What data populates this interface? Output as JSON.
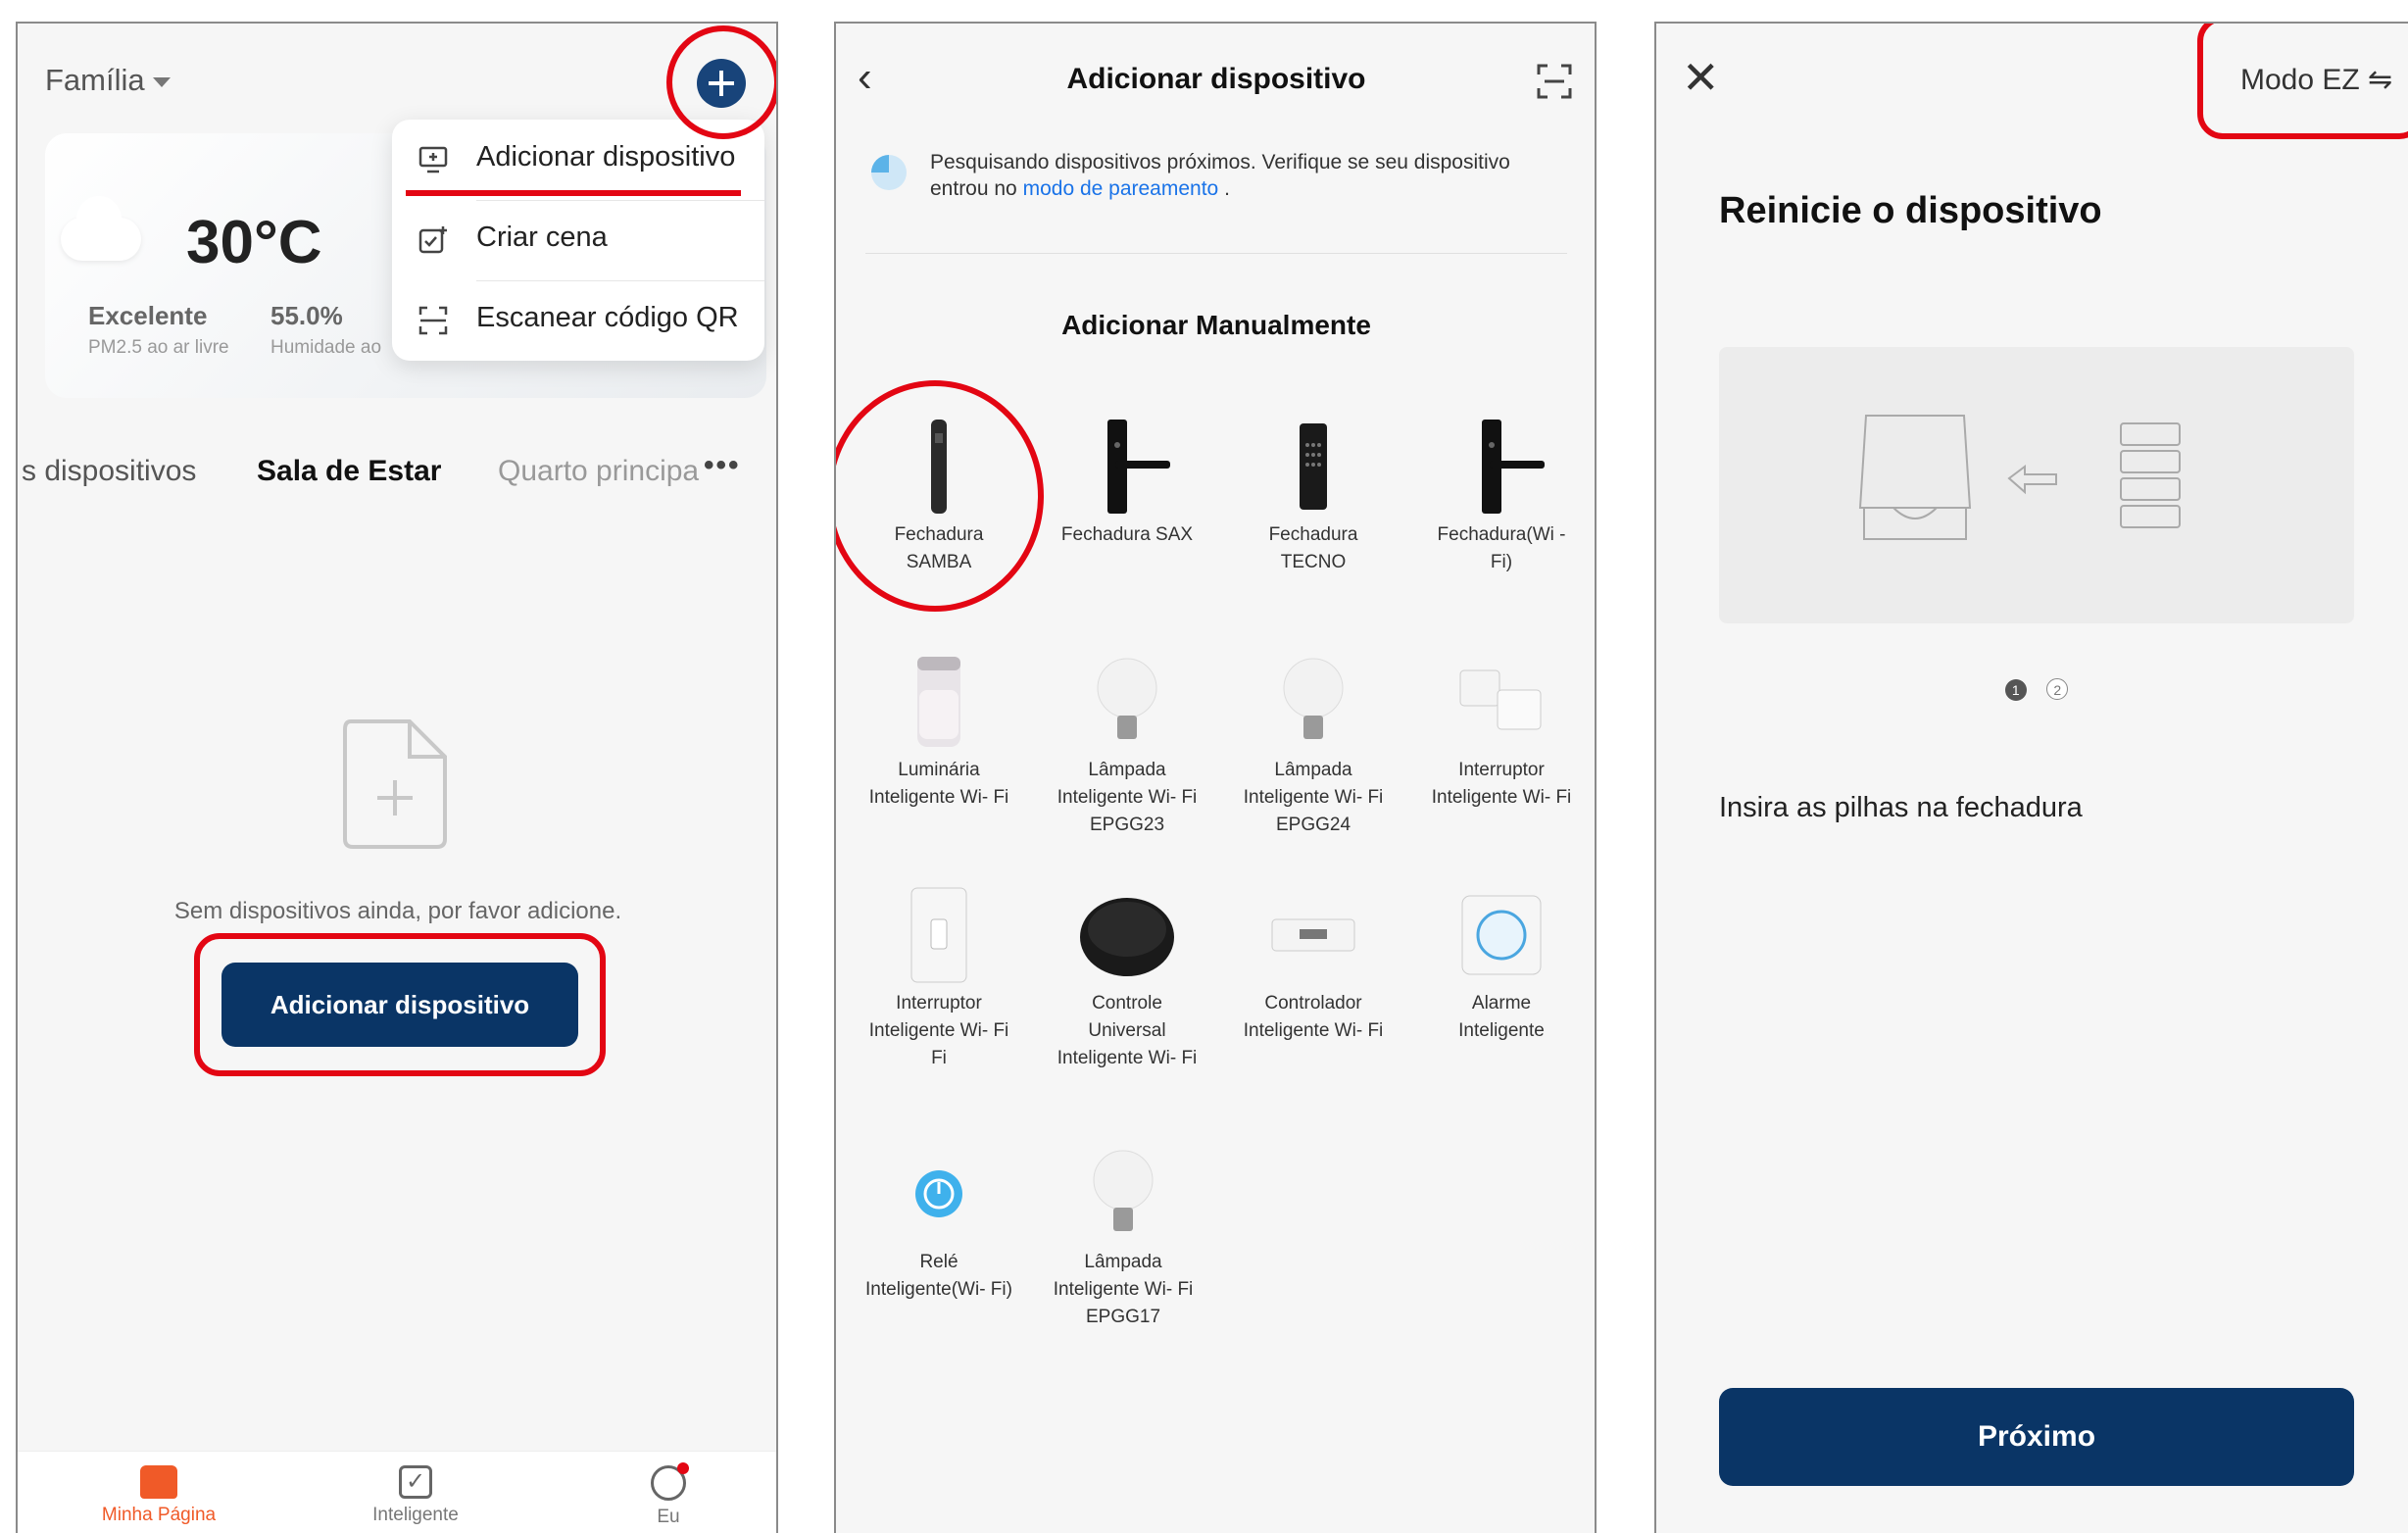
{
  "panel1": {
    "family_label": "Família",
    "temperature": "30°C",
    "air_quality_value": "Excelente",
    "air_quality_label": "PM2.5 ao ar livre",
    "humidity_value": "55.0%",
    "humidity_label": "Humidade ao",
    "menu": {
      "items": [
        {
          "label": "Adicionar dispositivo",
          "icon": "add-device-icon"
        },
        {
          "label": "Criar cena",
          "icon": "create-scene-icon"
        },
        {
          "label": "Escanear código QR",
          "icon": "qr-scan-icon"
        }
      ]
    },
    "tabs": [
      "s dispositivos",
      "Sala de Estar",
      "Quarto principa"
    ],
    "more_label": "•••",
    "empty_message": "Sem dispositivos ainda, por favor adicione.",
    "add_button": "Adicionar dispositivo",
    "bottom_nav": [
      {
        "label": "Minha Página",
        "active": true,
        "color": "#f05a28"
      },
      {
        "label": "Inteligente",
        "active": false
      },
      {
        "label": "Eu",
        "active": false
      }
    ]
  },
  "panel2": {
    "title": "Adicionar dispositivo",
    "search_text": "Pesquisando dispositivos próximos. Verifique se seu dispositivo entrou no",
    "search_link": "modo de pareamento",
    "search_end": ".",
    "manual_heading": "Adicionar Manualmente",
    "devices": [
      {
        "name": "Fechadura SAMBA"
      },
      {
        "name": "Fechadura SAX"
      },
      {
        "name": "Fechadura TECNO"
      },
      {
        "name": "Fechadura(Wi -Fi)"
      },
      {
        "name": "Luminária Inteligente Wi- Fi"
      },
      {
        "name": "Lâmpada Inteligente Wi- Fi EPGG23"
      },
      {
        "name": "Lâmpada Inteligente Wi- Fi EPGG24"
      },
      {
        "name": "Interruptor Inteligente Wi- Fi"
      },
      {
        "name": "Interruptor Inteligente Wi- Fi Fi"
      },
      {
        "name": "Controle Universal Inteligente Wi- Fi"
      },
      {
        "name": "Controlador Inteligente Wi- Fi"
      },
      {
        "name": "Alarme Inteligente"
      },
      {
        "name": "Relé Inteligente(Wi- Fi)"
      },
      {
        "name": "Lâmpada Inteligente Wi- Fi EPGG17"
      }
    ]
  },
  "panel3": {
    "mode_label": "Modo EZ ⇋",
    "title": "Reinicie o dispositivo",
    "step_current": "1",
    "step_next": "2",
    "instruction": "Insira as pilhas na fechadura",
    "next_button": "Próximo"
  },
  "colors": {
    "highlight": "#e30613",
    "primary_button": "#0a3566",
    "link": "#1a73e8"
  }
}
